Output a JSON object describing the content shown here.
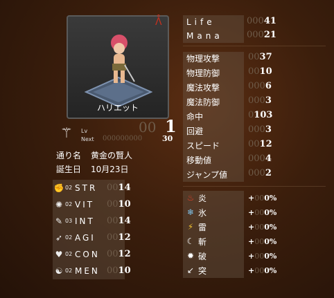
{
  "character": {
    "name": "ハリエット",
    "level_label": "Lv",
    "next_label": "Next",
    "level_pad": "00",
    "level": "1",
    "next_pad": "000000000",
    "next": "30",
    "nickname_label": "通り名",
    "nickname": "黄金の賢人",
    "birthday_label": "誕生日",
    "birthday": "10月23日"
  },
  "base_stats": [
    {
      "icon": "str-icon",
      "lvl": "02",
      "name": "STR",
      "pad": "00",
      "value": "14"
    },
    {
      "icon": "vit-icon",
      "lvl": "02",
      "name": "VIT",
      "pad": "00",
      "value": "10"
    },
    {
      "icon": "int-icon",
      "lvl": "03",
      "name": "INT",
      "pad": "00",
      "value": "14"
    },
    {
      "icon": "agi-icon",
      "lvl": "02",
      "name": "AGI",
      "pad": "00",
      "value": "12"
    },
    {
      "icon": "con-icon",
      "lvl": "02",
      "name": "CON",
      "pad": "00",
      "value": "12"
    },
    {
      "icon": "men-icon",
      "lvl": "02",
      "name": "MEN",
      "pad": "00",
      "value": "10"
    }
  ],
  "vitals": [
    {
      "label": "Life",
      "pad": "000",
      "value": "41"
    },
    {
      "label": "Mana",
      "pad": "000",
      "value": "21"
    }
  ],
  "combat": [
    {
      "label": "物理攻撃",
      "pad": "00",
      "value": "37"
    },
    {
      "label": "物理防御",
      "pad": "00",
      "value": "10"
    },
    {
      "label": "魔法攻撃",
      "pad": "000",
      "value": "6"
    },
    {
      "label": "魔法防御",
      "pad": "000",
      "value": "3"
    },
    {
      "label": "命中",
      "pad": "0",
      "value": "103"
    },
    {
      "label": "回避",
      "pad": "000",
      "value": "3"
    },
    {
      "label": "スピード",
      "pad": "00",
      "value": "12"
    },
    {
      "label": "移動値",
      "pad": "000",
      "value": "4"
    },
    {
      "label": "ジャンプ値",
      "pad": "000",
      "value": "2"
    }
  ],
  "elements": [
    {
      "icon": "fire-icon",
      "label": "炎",
      "sign": "+",
      "pad": "00",
      "value": "0%"
    },
    {
      "icon": "ice-icon",
      "label": "氷",
      "sign": "+",
      "pad": "00",
      "value": "0%"
    },
    {
      "icon": "thunder-icon",
      "label": "雷",
      "sign": "+",
      "pad": "00",
      "value": "0%"
    },
    {
      "icon": "slash-icon",
      "label": "斬",
      "sign": "+",
      "pad": "00",
      "value": "0%"
    },
    {
      "icon": "break-icon",
      "label": "破",
      "sign": "+",
      "pad": "00",
      "value": "0%"
    },
    {
      "icon": "pierce-icon",
      "label": "突",
      "sign": "+",
      "pad": "00",
      "value": "0%"
    }
  ],
  "colors": {
    "accent_red": "#c8301e",
    "pad_digit": "#6e5b49",
    "panel": "#6e5f50"
  }
}
